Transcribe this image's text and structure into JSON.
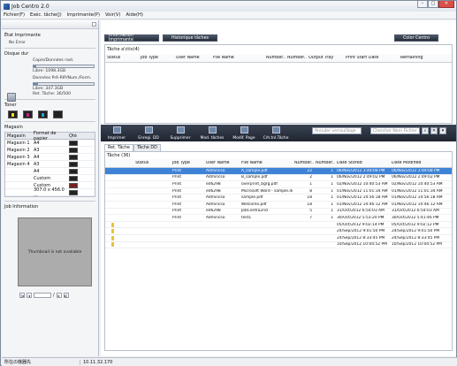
{
  "window": {
    "title": "Job Centro 2.0"
  },
  "menu": [
    "Fichier(F)",
    "Exéc. tâche(J)",
    "Imprimante(P)",
    "Voir(V)",
    "Aide(H)"
  ],
  "left": {
    "etat_label": "État Imprimante",
    "etat_value": "No Error",
    "disque_label": "Disque dur",
    "copie_label": "Copie/Données rast.",
    "copie_libre": "Libre: 1098.3GB",
    "copie_fill": 0.05,
    "donnees_label": "Données Prê-RIP/Num./Form.",
    "donnees_libre": "Libre: 347.3GB",
    "ret_tache": "Ret. Tâche: 36/500",
    "donnees_fill": 0.08,
    "toner_label": "Toner",
    "toner_colors": [
      "#e8e020",
      "#c02090",
      "#20a0d8",
      "#202020"
    ],
    "magasin_label": "Magasin",
    "paper_headers": [
      "Magasin",
      "Format de papier",
      "Qté"
    ],
    "paper_rows": [
      {
        "mag": "Magasin 1",
        "fmt": "A4",
        "red": false
      },
      {
        "mag": "Magasin 2",
        "fmt": "A3",
        "red": false
      },
      {
        "mag": "Magasin 3",
        "fmt": "A4",
        "red": false
      },
      {
        "mag": "Magasin 4",
        "fmt": "A3",
        "red": false
      },
      {
        "mag": "",
        "fmt": "A4",
        "red": false
      },
      {
        "mag": "",
        "fmt": "Custom",
        "red": false
      },
      {
        "mag": "",
        "fmt": "Custom",
        "red": true
      },
      {
        "mag": "",
        "fmt": "307.0 x 456.0 ...",
        "red": false
      }
    ],
    "job_info_label": "Job Information",
    "thumb_text": "Thumbnail is not available",
    "page_sep": "/"
  },
  "main": {
    "info_btn": "Information Imprimante",
    "hist_btn": "Historique tâches",
    "color_btn": "Color Centro",
    "top_title": "Tâche a'ctiv(4)",
    "top_headers": [
      "Status",
      "Job Type",
      "User Name",
      "File Name",
      "Number...",
      "Number...",
      "Output Tray",
      "Print Start Date",
      "Remaining"
    ],
    "tools": [
      "Imprimer",
      "Enregi. DD",
      "Supprimer",
      "Mod. tâches",
      "Modif. Page",
      "Crh.tnl.Tâche"
    ],
    "search_user": "Annuler verrouillage",
    "search_file": "Chercher Nom Fichier",
    "tabs": [
      "Ret. Tâche",
      "Tâche DD"
    ],
    "list_title": "Tâche (36)",
    "headers": [
      "",
      "",
      "Status",
      "Job Type",
      "User Name",
      "File Name",
      "Number...",
      "Number...",
      "Date Stored",
      "Date Modified"
    ],
    "rows": [
      {
        "lock": false,
        "sel": true,
        "type": "Print",
        "user": "Admincso",
        "file": "A_sample.pdf",
        "n1": "22",
        "n2": "1",
        "stored": "06/Nov/2012 3:49:08 PM",
        "mod": "06/Nov/2012 3:49:08 PM"
      },
      {
        "lock": false,
        "sel": false,
        "type": "Print",
        "user": "Admincso",
        "file": "B_sample.pdf",
        "n1": "2",
        "n2": "1",
        "stored": "06/Nov/2012 2:49:02 PM",
        "mod": "06/Nov/2012 2:49:02 PM"
      },
      {
        "lock": false,
        "sel": false,
        "type": "Print",
        "user": "e06298",
        "file": "overprint_bgrg.pdf",
        "n1": "1",
        "n2": "1",
        "stored": "02/Nov/2012 10:40:53 AM",
        "mod": "02/Nov/2012 10:40:53 AM"
      },
      {
        "lock": false,
        "sel": false,
        "type": "Print",
        "user": "e06298",
        "file": "Microsoft Word - sample.docx",
        "n1": "8",
        "n2": "1",
        "stored": "01/Nov/2012 11:01:34 AM",
        "mod": "01/Nov/2012 11:01:34 AM"
      },
      {
        "lock": false,
        "sel": false,
        "type": "Print",
        "user": "Admincso",
        "file": "sample.pdf",
        "n1": "18",
        "n2": "1",
        "stored": "01/Nov/2012 10:56:18 AM",
        "mod": "01/Nov/2012 10:56:18 AM"
      },
      {
        "lock": false,
        "sel": false,
        "type": "Print",
        "user": "Admincso",
        "file": "Welcome.pdf",
        "n1": "18",
        "n2": "1",
        "stored": "01/Nov/2012 10:46:12 AM",
        "mod": "01/Nov/2012 10:46:12 AM"
      },
      {
        "lock": false,
        "sel": false,
        "type": "Print",
        "user": "e06298",
        "file": "JobCentro2nd",
        "n1": "5",
        "n2": "1",
        "stored": "31/Oct/2012 6:54:03 AM",
        "mod": "31/Oct/2012 6:54:03 AM"
      },
      {
        "lock": false,
        "sel": false,
        "type": "Print",
        "user": "Admincso",
        "file": "test1",
        "n1": "7",
        "n2": "1",
        "stored": "30/Oct/2012 5:53:20 PM",
        "mod": "30/Oct/2012 5:41:46 PM"
      },
      {
        "lock": true,
        "sel": false,
        "type": "",
        "user": "",
        "file": "",
        "n1": "",
        "n2": "",
        "stored": "05/Oct/2012 9:02:14 PM",
        "mod": "05/Oct/2012 9:02:12 PM"
      },
      {
        "lock": true,
        "sel": false,
        "type": "",
        "user": "",
        "file": "",
        "n1": "",
        "n2": "",
        "stored": "24/Sep/2012 9:01:50 PM",
        "mod": "24/Sep/2012 9:01:50 PM"
      },
      {
        "lock": true,
        "sel": false,
        "type": "",
        "user": "",
        "file": "",
        "n1": "",
        "n2": "",
        "stored": "24/Sep/2012 8:33:45 PM",
        "mod": "24/Sep/2012 8:33:45 PM"
      },
      {
        "lock": true,
        "sel": false,
        "type": "",
        "user": "",
        "file": "",
        "n1": "",
        "n2": "",
        "stored": "10/Sep/2012 10:04:52 PM",
        "mod": "10/Sep/2012 10:04:52 PM"
      }
    ]
  },
  "status": {
    "left": "所在の機器先",
    "ip": "10.11.32.170"
  }
}
